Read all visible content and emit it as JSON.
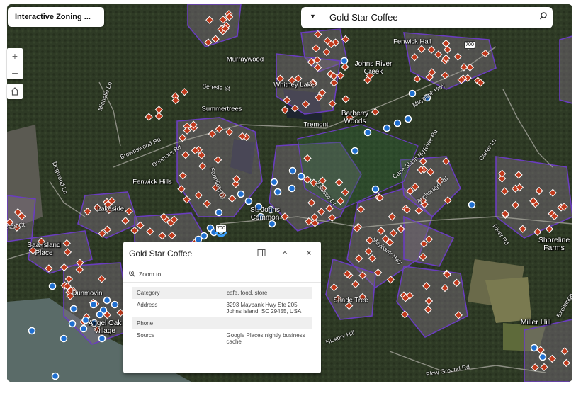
{
  "app": {
    "title": "Interactive Zoning ..."
  },
  "search": {
    "dropdown_glyph": "▼",
    "value": "Gold Star Coffee"
  },
  "controls": {
    "zoom_in": "+",
    "zoom_out": "–"
  },
  "map": {
    "places": [
      "Murraywood",
      "Fenwick Hall",
      "Johns River\nCreek",
      "Whitney Lake",
      "Summertrees",
      "Barberry\nWoods",
      "Tremont",
      "Fenwick Hills",
      "Lakeside",
      "St. Johns\nCommon",
      "Saa Island\nPlace",
      "Dunmovin",
      "Angel Oak\nVillage",
      "Shade Tree",
      "Shoreline\nFarms",
      "Miller Hill"
    ],
    "roads": [
      "Seresie St",
      "Michelle Ln",
      "Brownswood Rd",
      "Dunmore Rd",
      "Farmfield Dr",
      "Zalesco Dr",
      "Cane Slash Rd",
      "River Rd",
      "Carter Ln",
      "Maybank Hwy",
      "Anchorage Rd",
      "River Rd",
      "Plow Ground Rd",
      "Exchange",
      "Dogwood Ln",
      "Maybank Hwy",
      "Hickory Hill",
      "Saa Ct"
    ],
    "shields": [
      "700",
      "700"
    ]
  },
  "popup": {
    "title": "Gold Star Coffee",
    "zoom_label": "Zoom to",
    "rows": [
      {
        "key": "Category",
        "value": "cafe, food, store"
      },
      {
        "key": "Address",
        "value": "3293 Maybank Hwy Ste 205, Johns Island, SC 29455, USA"
      },
      {
        "key": "Phone",
        "value": ""
      },
      {
        "key": "Source",
        "value": "Google Places nightly business cache"
      }
    ]
  },
  "colors": {
    "zone_outline": "#6a3dbf",
    "poi_marker": "#c0391b",
    "blue_marker": "#1f6fd0",
    "map_ground": "#2b3524"
  }
}
